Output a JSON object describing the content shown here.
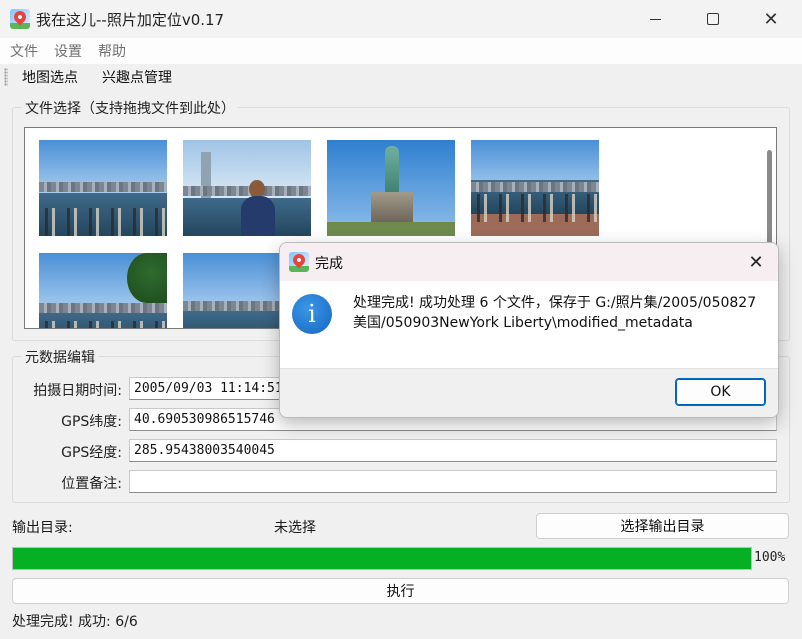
{
  "window": {
    "title": "我在这儿--照片加定位v0.17"
  },
  "menu": [
    "文件",
    "设置",
    "帮助"
  ],
  "toolbar": [
    "地图选点",
    "兴趣点管理"
  ],
  "file_group": {
    "title": "文件选择（支持拖拽文件到此处）"
  },
  "metadata_group": {
    "title": "元数据编辑",
    "fields": [
      {
        "label": "拍摄日期时间:",
        "value": "2005/09/03 11:14:51"
      },
      {
        "label": "GPS纬度:",
        "value": "40.690530986515746"
      },
      {
        "label": "GPS经度:",
        "value": "285.95438003540045"
      },
      {
        "label": "位置备注:",
        "value": ""
      }
    ]
  },
  "output": {
    "label": "输出目录:",
    "value": "未选择",
    "button": "选择输出目录"
  },
  "progress": {
    "percent": 100,
    "text": "100%",
    "color": "#06b025"
  },
  "execute_button": "执行",
  "status": "处理完成! 成功: 6/6",
  "dialog": {
    "title": "完成",
    "message": "处理完成! 成功处理 6 个文件，保存于 G:/照片集/2005/050827美国/050903NewYork Liberty\\modified_metadata",
    "ok": "OK",
    "icon": "info-icon"
  }
}
